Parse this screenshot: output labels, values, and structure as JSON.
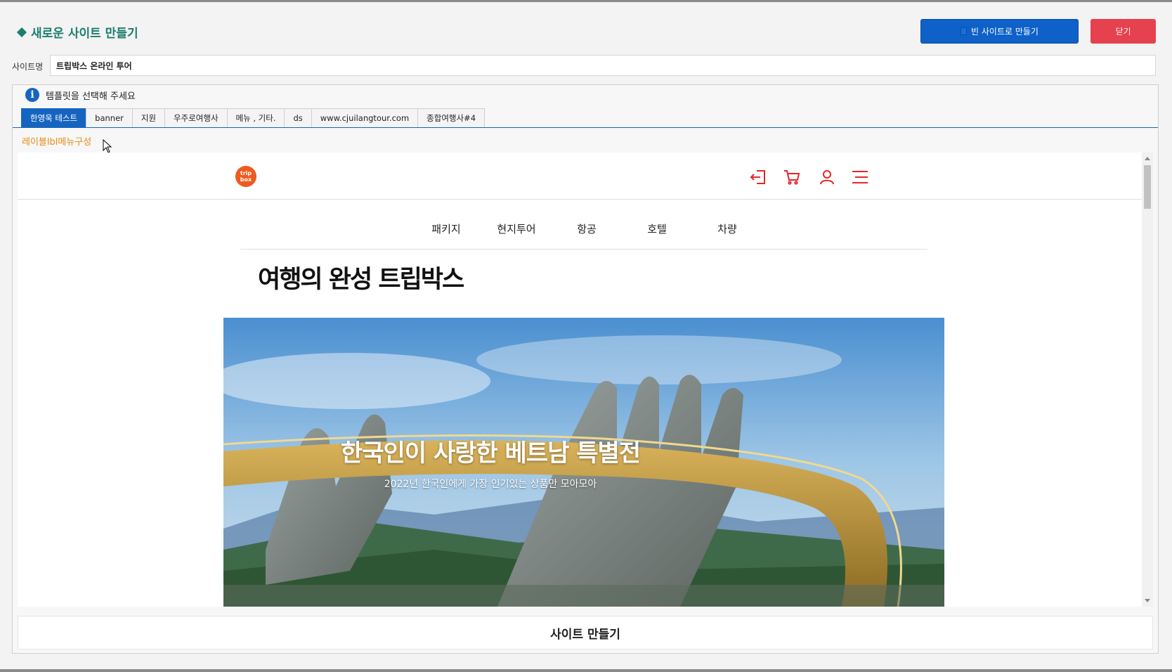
{
  "dialog": {
    "title": "새로운 사이트 만들기",
    "blank_button": "빈 사이트로 만들기",
    "close_button": "닫기"
  },
  "site_name": {
    "label": "사이트명",
    "value": "트립박스 온라인 투어"
  },
  "template": {
    "info": "템플릿을 선택해 주세요",
    "tabs": [
      "한영욱 테스트",
      "banner",
      "지원",
      "우주로여행사",
      "메뉴 , 기타.",
      "ds",
      "www.cjuilangtour.com",
      "종합여행사#4"
    ],
    "active_tab": "한영욱 테스트",
    "sub_link": "레이블lbl메뉴구성"
  },
  "preview": {
    "logo": {
      "line1": "trip",
      "line2": "box"
    },
    "nav": [
      "패키지",
      "현지투어",
      "항공",
      "호텔",
      "차량"
    ],
    "title": "여행의 완성 트립박스",
    "hero": {
      "main": "한국인이 사랑한 베트남 특별전",
      "sub": "2022년 한국인에게 가장 인기있는 상품만 모아모아"
    },
    "header_icons": [
      "login-icon",
      "cart-icon",
      "user-icon",
      "menu-icon"
    ],
    "accent_color": "#e5252a"
  },
  "make_button": "사이트 만들기"
}
